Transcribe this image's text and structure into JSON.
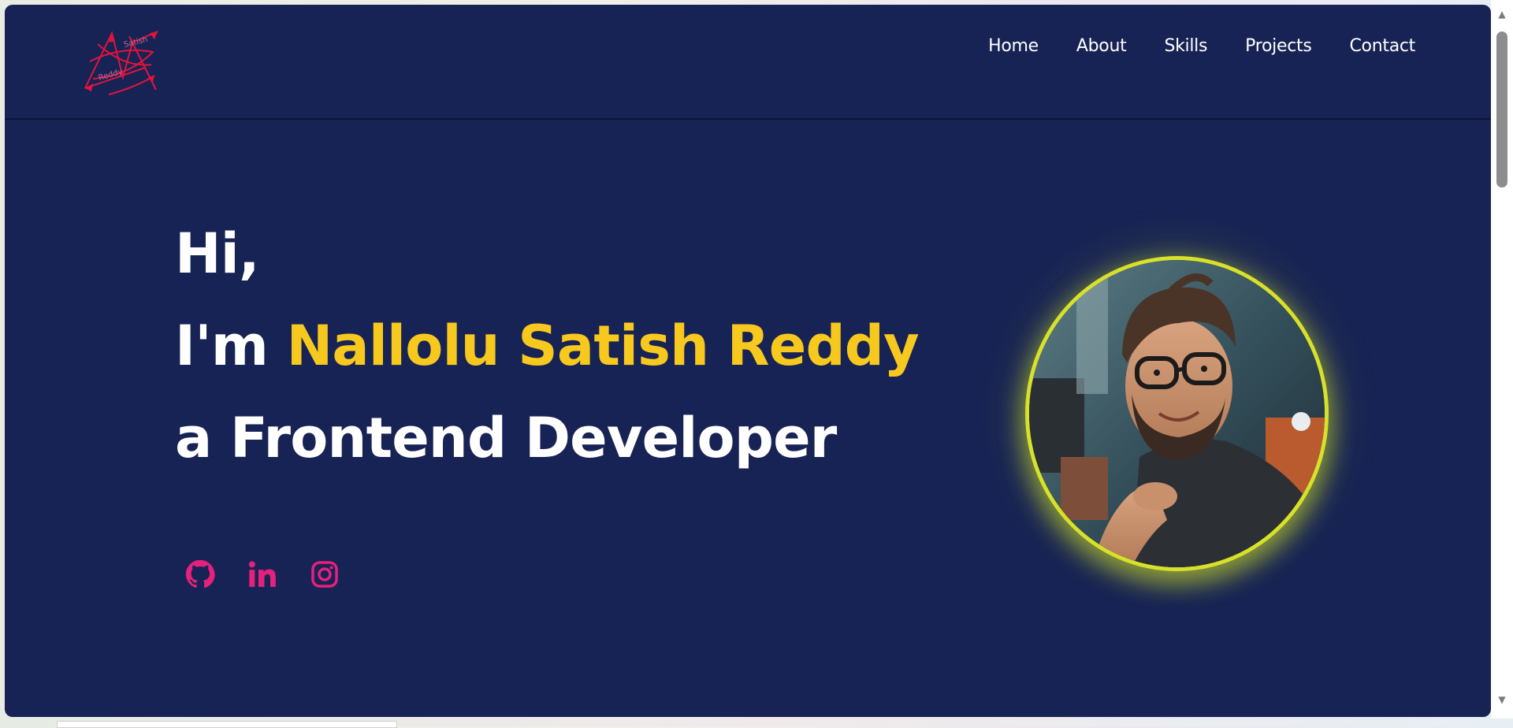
{
  "colors": {
    "background": "#172354",
    "highlight": "#f7c81e",
    "social_icon": "#e4217c",
    "logo": "#e0143c",
    "glow": "#d7e12a"
  },
  "logo": {
    "text_top": "Satish",
    "text_bottom": "Reddy"
  },
  "nav": {
    "items": [
      {
        "label": "Home"
      },
      {
        "label": "About"
      },
      {
        "label": "Skills"
      },
      {
        "label": "Projects"
      },
      {
        "label": "Contact"
      }
    ]
  },
  "hero": {
    "greeting": "Hi,",
    "intro_prefix": "I'm ",
    "name": "Nallolu Satish Reddy",
    "role": "a Frontend Developer"
  },
  "socials": [
    {
      "icon": "github-icon"
    },
    {
      "icon": "linkedin-icon"
    },
    {
      "icon": "instagram-icon"
    }
  ],
  "profile": {
    "icon": "profile-photo"
  }
}
